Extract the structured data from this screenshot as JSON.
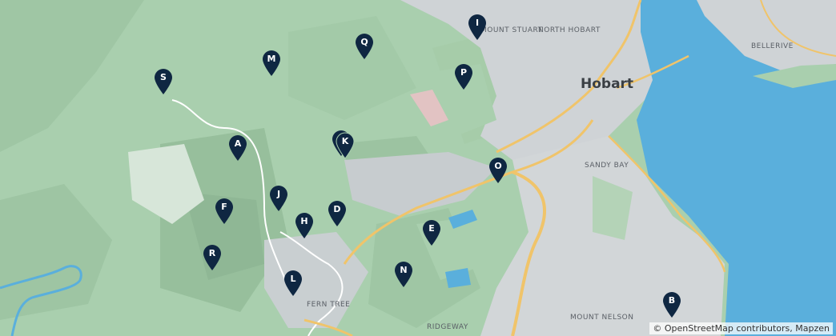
{
  "place_labels": {
    "hobart": "Hobart",
    "mount_stuart": "MOUNT STUART",
    "north_hobart": "NORTH HOBART",
    "bellerive": "BELLERIVE",
    "sandy_bay": "SANDY BAY",
    "fern_tree": "FERN TREE",
    "mount_nelson": "MOUNT NELSON",
    "ridgeway": "RIDGEWAY"
  },
  "markers": [
    "I",
    "Q",
    "M",
    "P",
    "S",
    "K",
    "A",
    "O",
    "J",
    "F",
    "D",
    "H",
    "E",
    "R",
    "N",
    "L",
    "B"
  ],
  "attribution": "© OpenStreetMap contributors, Mapzen",
  "colors": {
    "marker": "#0f2742",
    "water": "#5aafdc",
    "urban": "#cfd3d6",
    "park": "#a9cfae"
  }
}
